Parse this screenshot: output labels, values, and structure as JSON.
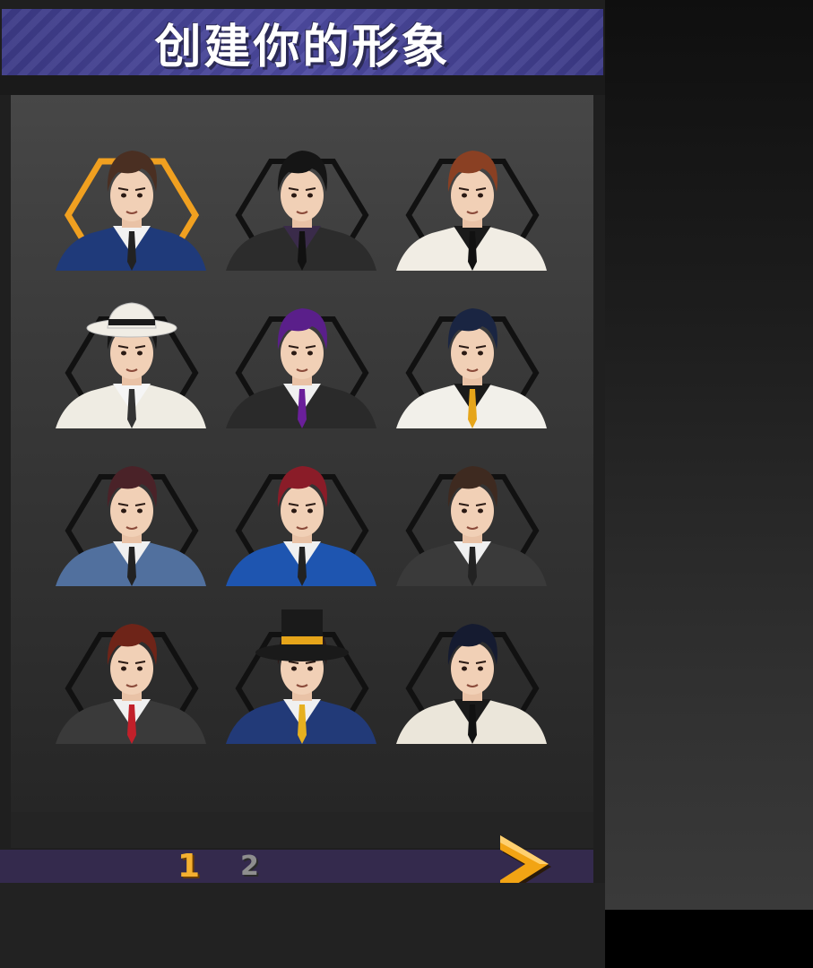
{
  "title": "创建你的形象",
  "avatars": [
    {
      "name": "avatar-1",
      "hair": "#4a2f22",
      "suit": "#1f3a7a",
      "shirt": "#f2f2f2",
      "tie": "#222",
      "hex": "#f0a020",
      "selected": true
    },
    {
      "name": "avatar-2",
      "hair": "#151515",
      "suit": "#2c2c2c",
      "shirt": "#3a2b4a",
      "tie": "#111",
      "hex": "#111111",
      "selected": false
    },
    {
      "name": "avatar-3",
      "hair": "#8a4023",
      "suit": "#f1ede4",
      "shirt": "#1a1a1a",
      "tie": "#111",
      "hex": "#111111",
      "selected": false
    },
    {
      "name": "avatar-4",
      "hair": "#161616",
      "suit": "#efece3",
      "shirt": "#f5f5f5",
      "tie": "#333",
      "hex": "#111111",
      "selected": false,
      "hat": "#f0ede5"
    },
    {
      "name": "avatar-5",
      "hair": "#5a1f8a",
      "suit": "#2a2a2a",
      "shirt": "#f0f0f0",
      "tie": "#6a1f9a",
      "hex": "#111111",
      "selected": false
    },
    {
      "name": "avatar-6",
      "hair": "#1a2542",
      "suit": "#f2f0ea",
      "shirt": "#1a1a1a",
      "tie": "#e6a51a",
      "hex": "#111111",
      "selected": false
    },
    {
      "name": "avatar-7",
      "hair": "#4a2228",
      "suit": "#51709e",
      "shirt": "#f0f0f0",
      "tie": "#222",
      "hex": "#111111",
      "selected": false
    },
    {
      "name": "avatar-8",
      "hair": "#8a1c28",
      "suit": "#1e55b0",
      "shirt": "#f0f0f0",
      "tie": "#222",
      "hex": "#111111",
      "selected": false
    },
    {
      "name": "avatar-9",
      "hair": "#3e2a20",
      "suit": "#3a3a3a",
      "shirt": "#f0f0f0",
      "tie": "#222",
      "hex": "#111111",
      "selected": false
    },
    {
      "name": "avatar-10",
      "hair": "#6e2418",
      "suit": "#3a3a3a",
      "shirt": "#f0f0f0",
      "tie": "#c2202a",
      "hex": "#111111",
      "selected": false
    },
    {
      "name": "avatar-11",
      "hair": "#2a1a18",
      "suit": "#223a78",
      "shirt": "#f0f0f0",
      "tie": "#e6b020",
      "hex": "#111111",
      "selected": false,
      "tophat": "#1a1a1a"
    },
    {
      "name": "avatar-12",
      "hair": "#151b30",
      "suit": "#ebe6da",
      "shirt": "#1a1a1a",
      "tie": "#111",
      "hex": "#111111",
      "selected": false
    }
  ],
  "pagination": {
    "pages": [
      "1",
      "2"
    ],
    "current": "1",
    "next_icon": "chevron-right-icon"
  },
  "colors": {
    "title_bar": "#4a479a",
    "accent": "#f0a020",
    "page_bar": "#342a4d"
  }
}
